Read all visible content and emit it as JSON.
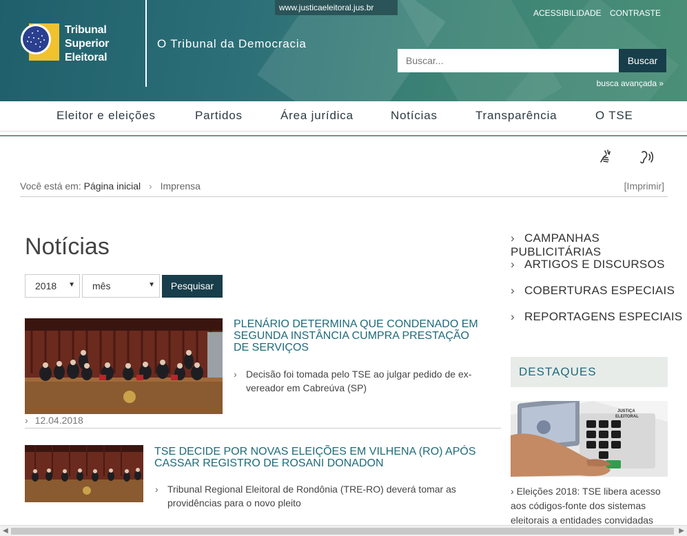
{
  "header": {
    "url": "www.justicaeleitoral.jus.br",
    "logo_lines": [
      "Tribunal",
      "Superior",
      "Eleitoral"
    ],
    "tagline": "O Tribunal da Democracia",
    "accessibility": "ACESSIBILIDADE",
    "contrast": "CONTRASTE",
    "search_placeholder": "Buscar...",
    "search_button": "Buscar",
    "advanced_search": "busca avançada »"
  },
  "nav": [
    "Eleitor e eleições",
    "Partidos",
    "Área jurídica",
    "Notícias",
    "Transparência",
    "O TSE"
  ],
  "breadcrumb": {
    "prefix": "Você está em:",
    "home": "Página inicial",
    "sep": "›",
    "current": "Imprensa",
    "print": "[Imprimir]"
  },
  "page_title": "Notícias",
  "filters": {
    "year": "2018",
    "month": "mês",
    "submit": "Pesquisar"
  },
  "news": [
    {
      "title": "PLENÁRIO DETERMINA QUE CONDENADO EM SEGUNDA INSTÂNCIA CUMPRA PRESTAÇÃO DE SERVIÇOS",
      "desc": "Decisão foi tomada pelo TSE ao julgar pedido de ex-vereador em Cabreúva (SP)",
      "date": "12.04.2018"
    },
    {
      "title": "TSE DECIDE POR NOVAS ELEIÇÕES EM VILHENA (RO) APÓS CASSAR REGISTRO DE ROSANI DONADON",
      "desc": "Tribunal Regional Eleitoral de Rondônia (TRE-RO) deverá tomar as providências para o novo pleito"
    }
  ],
  "sidebar": {
    "links": [
      "CAMPANHAS PUBLICITÁRIAS",
      "ARTIGOS E DISCURSOS",
      "COBERTURAS ESPECIAIS",
      "REPORTAGENS ESPECIAIS"
    ],
    "destaques_title": "DESTAQUES",
    "destaques_text": "Eleições 2018: TSE libera acesso aos códigos-fonte dos sistemas eleitorais a entidades convidadas",
    "urna_label_1": "JUSTIÇA",
    "urna_label_2": "ELEITORAL"
  },
  "colors": {
    "header_dark": "#1f5f6b",
    "header_light": "#4b8f77",
    "button_dark": "#173e4a",
    "link_teal": "#1f6a7a"
  },
  "icons": [
    "sign-language-icon",
    "audio-accessibility-icon",
    "chevron-right-icon",
    "caret-down-icon"
  ]
}
